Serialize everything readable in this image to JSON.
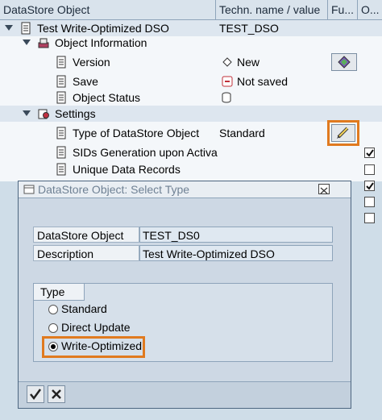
{
  "header": {
    "col1": "DataStore Object",
    "col2": "Techn. name / value",
    "col3": "Fu...",
    "col4": "O..."
  },
  "tree": {
    "root": {
      "label": "Test Write-Optimized DSO",
      "value": "TEST_DSO"
    },
    "object_information": {
      "label": "Object Information"
    },
    "version": {
      "label": "Version",
      "value": "New"
    },
    "save": {
      "label": "Save",
      "value": "Not saved"
    },
    "object_status": {
      "label": "Object Status"
    },
    "settings": {
      "label": "Settings"
    },
    "type": {
      "label": "Type of DataStore Object",
      "value": "Standard"
    },
    "sids": {
      "label": "SIDs Generation upon Activati"
    },
    "unique": {
      "label": "Unique Data Records"
    }
  },
  "checkboxes": [
    true,
    false,
    true,
    false,
    false
  ],
  "dialog": {
    "title": "DataStore Object: Select Type",
    "fields": {
      "object_label": "DataStore Object",
      "object_value": "TEST_DS0",
      "desc_label": "Description",
      "desc_value": "Test Write-Optimized DSO"
    },
    "type_group": {
      "label": "Type",
      "options": [
        "Standard",
        "Direct Update",
        "Write-Optimized"
      ],
      "selected": "Write-Optimized"
    }
  },
  "colors": {
    "highlight": "#e07a1f",
    "header_bg": "#d9e3ec",
    "band_bg": "#dde6ef"
  }
}
